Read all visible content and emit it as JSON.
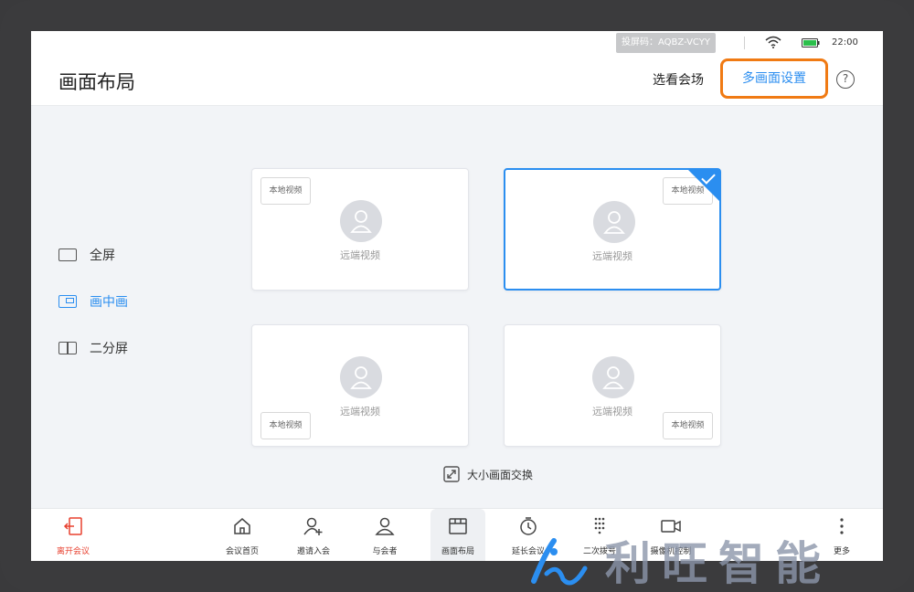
{
  "status_bar": {
    "cast_code": "投屏码：AQBZ-VCYY",
    "time": "22:00"
  },
  "header": {
    "title": "画面布局",
    "select_venue": "选看会场",
    "multi_screen_settings": "多画面设置",
    "help": "?"
  },
  "layout_menu": {
    "items": [
      {
        "label": "全屏",
        "active": false
      },
      {
        "label": "画中画",
        "active": true
      },
      {
        "label": "二分屏",
        "active": false
      }
    ]
  },
  "cards": [
    {
      "local_label": "本地视频",
      "remote_label": "远端视频",
      "selected": false
    },
    {
      "local_label": "本地视频",
      "remote_label": "远端视频",
      "selected": true
    },
    {
      "local_label": "本地视频",
      "remote_label": "远端视频",
      "selected": false
    },
    {
      "local_label": "本地视频",
      "remote_label": "远端视频",
      "selected": false
    }
  ],
  "swap_label": "大小画面交换",
  "bottom_nav": {
    "leave": "离开会议",
    "items": [
      {
        "label": "会议首页",
        "icon": "home-icon"
      },
      {
        "label": "邀请入会",
        "icon": "add-user-icon"
      },
      {
        "label": "与会者",
        "icon": "user-icon"
      },
      {
        "label": "画面布局",
        "icon": "layout-icon"
      },
      {
        "label": "延长会议",
        "icon": "timer-icon"
      },
      {
        "label": "二次拨号",
        "icon": "dialpad-icon"
      },
      {
        "label": "摄像机控制",
        "icon": "camera-icon"
      },
      {
        "label": "更多",
        "icon": "more-icon"
      }
    ]
  },
  "watermark": {
    "text": "利旺智能"
  },
  "colors": {
    "accent": "#2b8ef0",
    "highlight": "#f07a13",
    "danger": "#e8402f"
  }
}
